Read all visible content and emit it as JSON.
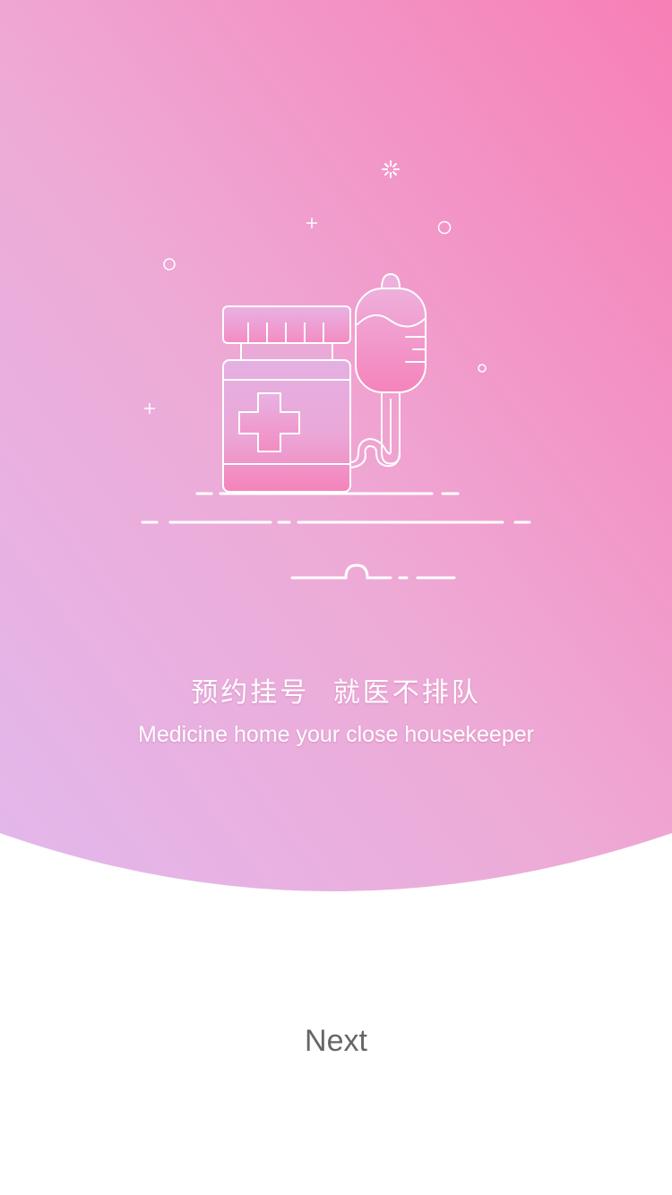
{
  "colors": {
    "gradient_top_right": "#f77fb6",
    "gradient_bottom_left": "#e2b8ec",
    "line": "#ffffff",
    "next_text": "#666666"
  },
  "onboarding": {
    "title": "预约挂号  就医不排队",
    "subtitle": "Medicine home your close housekeeper",
    "illustration": "medicine-bottle-and-iv-bag-icon"
  },
  "footer": {
    "next_label": "Next"
  }
}
